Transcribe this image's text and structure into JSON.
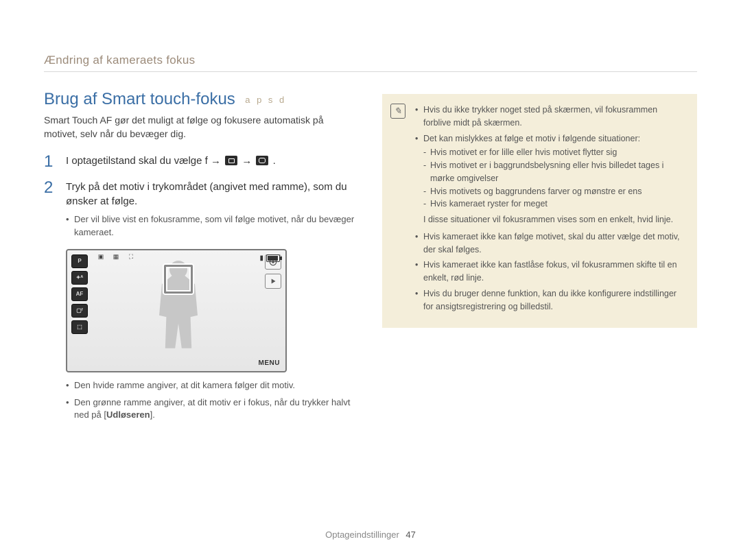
{
  "breadcrumb": "Ændring af kameraets fokus",
  "title": "Brug af Smart touch-fokus",
  "modes": "a p s d",
  "subtitle": "Smart Touch AF gør det muligt at følge og fokusere automatisk på motivet, selv når du bevæger dig.",
  "steps": [
    {
      "num": "1",
      "text_pre": "I optagetilstand skal du vælge  f   → ",
      "text_mid": " → ",
      "text_post": "."
    },
    {
      "num": "2",
      "text": "Tryk på det motiv i trykområdet (angivet med ramme), som du ønsker at følge.",
      "bullets": [
        "Der vil blive vist en fokusramme, som vil følge motivet, når du bevæger kameraet."
      ]
    }
  ],
  "after_image_bullets": [
    "Den hvide ramme angiver, at dit kamera følger dit motiv.",
    "Den grønne ramme angiver, at dit motiv er i fokus, når du trykker halvt ned på [",
    "]."
  ],
  "after_image_bold": "Udløseren",
  "camera_ui": {
    "left_icons": [
      "P",
      "✦ᴬ",
      "AF",
      "▢ᶠ",
      "⬚"
    ],
    "top_icons": [
      "▣",
      "▦",
      "⛶"
    ],
    "menu_label": "MENU"
  },
  "note": {
    "items": [
      {
        "text": "Hvis du ikke trykker noget sted på skærmen, vil fokusrammen forblive midt på skærmen."
      },
      {
        "text": "Det kan mislykkes at følge et motiv i følgende situationer:",
        "sub": [
          "Hvis motivet er for lille eller hvis motivet flytter sig",
          "Hvis motivet er i baggrundsbelysning eller hvis billedet tages i mørke omgivelser",
          "Hvis motivets og baggrundens farver og mønstre er ens",
          "Hvis kameraet ryster for meget"
        ],
        "after": "I disse situationer vil fokusrammen vises som en enkelt, hvid linje."
      },
      {
        "text": "Hvis kameraet ikke kan følge motivet, skal du atter vælge det motiv, der skal følges."
      },
      {
        "text": "Hvis kameraet ikke kan fastlåse fokus, vil fokusrammen skifte til en enkelt, rød linje."
      },
      {
        "text": "Hvis du bruger denne funktion, kan du ikke konfigurere indstillinger for ansigtsregistrering og billedstil."
      }
    ]
  },
  "footer": {
    "section": "Optageindstillinger",
    "page": "47"
  }
}
